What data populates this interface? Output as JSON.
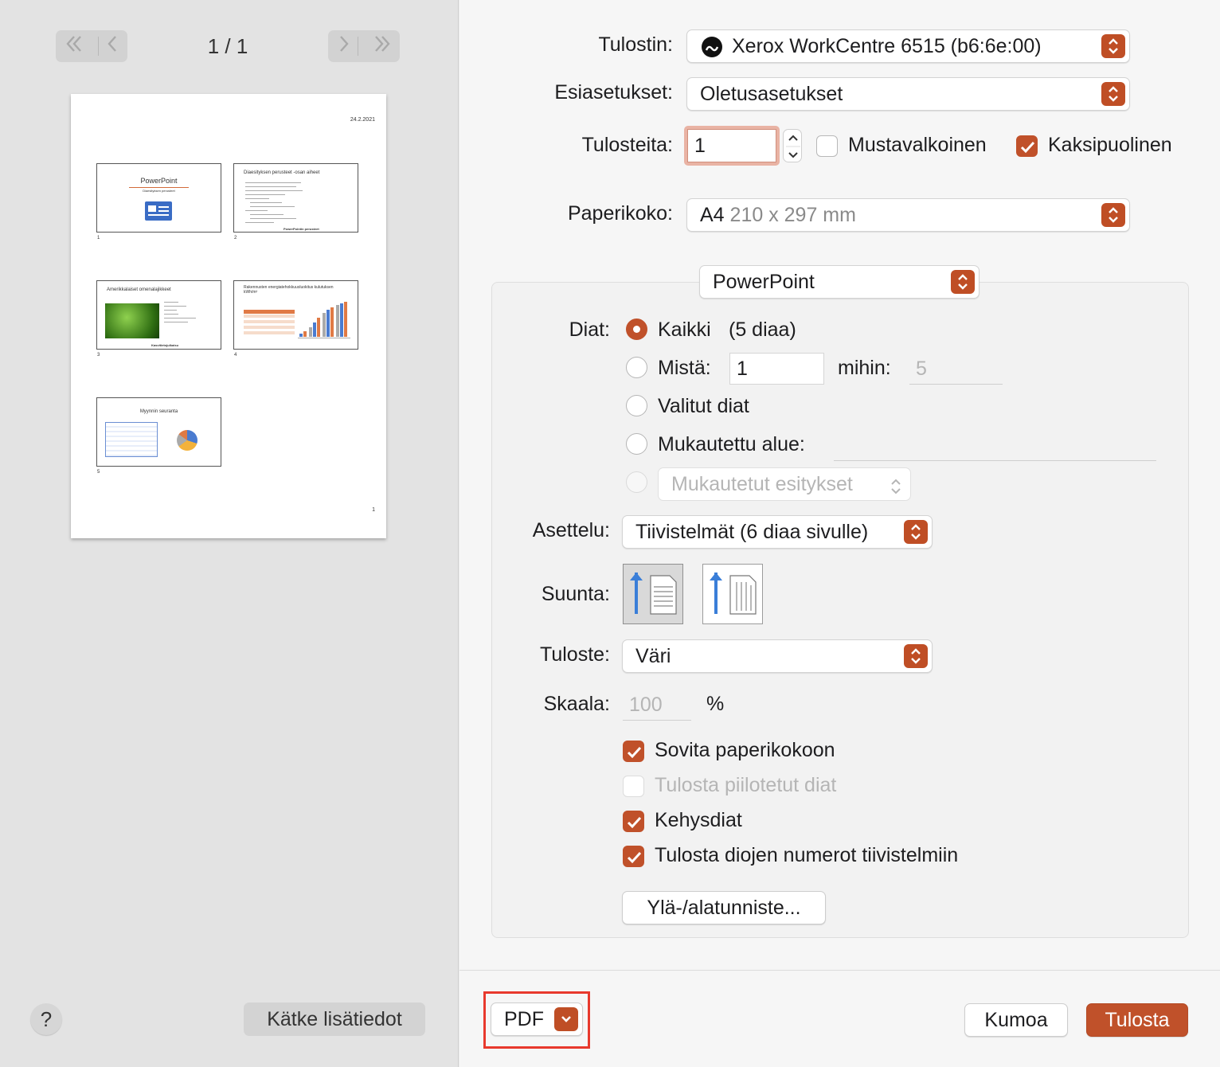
{
  "preview": {
    "first_icon": "double-chevron-left-icon",
    "prev_icon": "chevron-left-icon",
    "next_icon": "chevron-right-icon",
    "last_icon": "double-chevron-right-icon",
    "page_indicator": "1 / 1",
    "sheet": {
      "date": "24.2.2021",
      "page_number": "1",
      "slides": [
        {
          "num": "1",
          "title": "PowerPoint",
          "subtitle": "Diaesityksen perusteet"
        },
        {
          "num": "2",
          "title": "Diaesityksen perusteet -osan aiheet",
          "footer": "PowerPointin perusteet"
        },
        {
          "num": "3",
          "title": "Amerikkalaiset omenalajikkeet",
          "footer": "Kasvitietojulkaisu"
        },
        {
          "num": "4",
          "title": "Rakennusten energiatehokkuusluokitus kulutuksen kWh/m²"
        },
        {
          "num": "5",
          "title": "Myynnin seuranta"
        }
      ]
    },
    "help_label": "?",
    "hide_details_label": "Kätke lisätiedot"
  },
  "printer": {
    "label": "Tulostin:",
    "value": "Xerox WorkCentre 6515 (b6:6e:00)",
    "icon": "printer-status-icon"
  },
  "presets": {
    "label": "Esiasetukset:",
    "value": "Oletusasetukset"
  },
  "copies": {
    "label": "Tulosteita:",
    "value": "1",
    "bw_label": "Mustavalkoinen",
    "bw_checked": false,
    "duplex_label": "Kaksipuolinen",
    "duplex_checked": true
  },
  "paper": {
    "label": "Paperikoko:",
    "value": "A4",
    "detail": "210 x 297 mm"
  },
  "app_menu": {
    "value": "PowerPoint"
  },
  "slides": {
    "label": "Diat:",
    "all_label": "Kaikki",
    "all_count": "(5 diaa)",
    "from_label": "Mistä:",
    "from_value": "1",
    "to_label": "mihin:",
    "to_placeholder": "5",
    "selected_label": "Valitut diat",
    "custom_range_label": "Mukautettu alue:",
    "custom_shows_label": "Mukautetut esitykset"
  },
  "layout": {
    "label": "Asettelu:",
    "value": "Tiivistelmät (6 diaa sivulle)"
  },
  "orientation": {
    "label": "Suunta:",
    "portrait_icon": "portrait-orientation-icon",
    "landscape_icon": "landscape-orientation-icon",
    "selected": "portrait"
  },
  "output": {
    "label": "Tuloste:",
    "value": "Väri"
  },
  "scale": {
    "label": "Skaala:",
    "placeholder": "100",
    "unit": "%"
  },
  "options": {
    "fit_label": "Sovita paperikokoon",
    "fit_checked": true,
    "hidden_label": "Tulosta piilotetut diat",
    "hidden_checked": false,
    "frame_label": "Kehysdiat",
    "frame_checked": true,
    "numbers_label": "Tulosta diojen numerot tiivistelmiin",
    "numbers_checked": true
  },
  "header_footer_label": "Ylä-/alatunniste...",
  "footer": {
    "pdf_label": "PDF",
    "cancel_label": "Kumoa",
    "print_label": "Tulosta"
  },
  "colors": {
    "accent": "#c0512a",
    "highlight_box": "#e8392d"
  }
}
